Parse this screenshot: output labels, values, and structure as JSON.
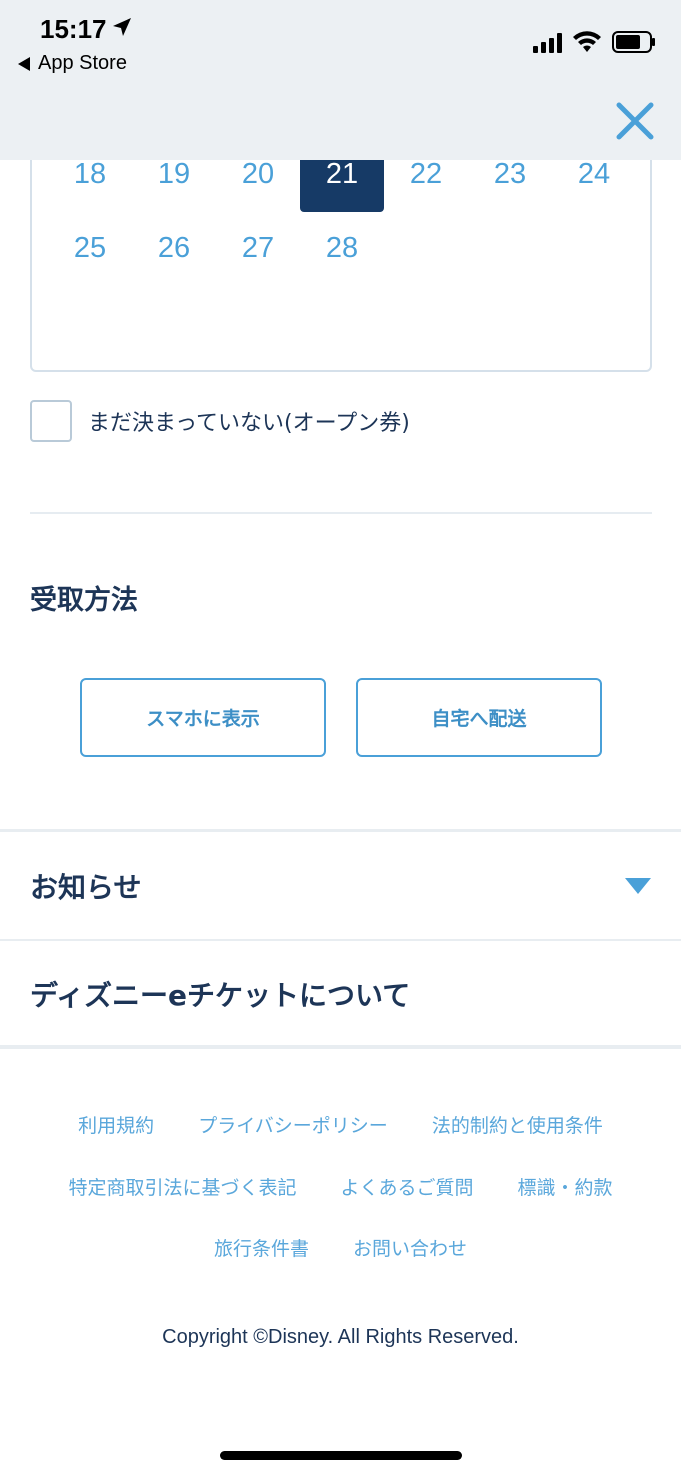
{
  "status_bar": {
    "time": "15:17",
    "back_app": "App Store"
  },
  "calendar": {
    "rows": [
      [
        "18",
        "19",
        "20",
        "21",
        "22",
        "23",
        "24"
      ],
      [
        "25",
        "26",
        "27",
        "28"
      ]
    ],
    "selected_day": "21"
  },
  "open_ticket": {
    "label": "まだ決まっていない(オープン券)",
    "checked": false
  },
  "receipt": {
    "title": "受取方法",
    "options": [
      "スマホに表示",
      "自宅へ配送"
    ]
  },
  "notice": {
    "title": "お知らせ"
  },
  "about": {
    "title": "ディズニーeチケットについて"
  },
  "footer": {
    "row1": [
      "利用規約",
      "プライバシーポリシー",
      "法的制約と使用条件"
    ],
    "row2": [
      "特定商取引法に基づく表記",
      "よくあるご質問",
      "標識・約款"
    ],
    "row3": [
      "旅行条件書",
      "お問い合わせ"
    ],
    "copyright": "Copyright ©Disney. All Rights Reserved."
  },
  "colors": {
    "accent": "#4aa0d8",
    "selected_bg": "#163a66",
    "heading": "#1d3557",
    "topbar_bg": "#ecf0f3"
  }
}
